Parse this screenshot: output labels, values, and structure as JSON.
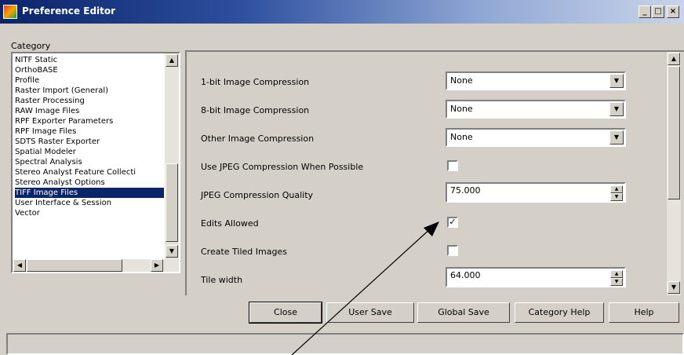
{
  "window": {
    "title": "Preference Editor",
    "minimize_label": "_",
    "maximize_label": "□",
    "close_label": "×"
  },
  "category": {
    "label": "Category",
    "items": [
      "NITF Static",
      "OrthoBASE",
      "Profile",
      "Raster Import (General)",
      "Raster Processing",
      "RAW Image Files",
      "RPF Exporter Parameters",
      "RPF Image Files",
      "SDTS Raster Exporter",
      "Spatial Modeler",
      "Spectral Analysis",
      "Stereo Analyst Feature Collecti",
      "Stereo Analyst Options",
      "TIFF Image Files",
      "User Interface & Session",
      "Vector"
    ],
    "selected": "TIFF Image Files"
  },
  "preferences": {
    "one_bit_label": "1-bit Image Compression",
    "one_bit_value": "None",
    "eight_bit_label": "8-bit Image Compression",
    "eight_bit_value": "None",
    "other_label": "Other Image Compression",
    "other_value": "None",
    "use_jpeg_label": "Use JPEG Compression When Possible",
    "use_jpeg_checked": false,
    "jpeg_quality_label": "JPEG Compression Quality",
    "jpeg_quality_value": "75.000",
    "edits_allowed_label": "Edits Allowed",
    "edits_allowed_checked": true,
    "create_tiled_label": "Create Tiled Images",
    "create_tiled_checked": false,
    "tile_width_label": "Tile width",
    "tile_width_value": "64.000"
  },
  "buttons": {
    "close": "Close",
    "user_save": "User Save",
    "global_save": "Global Save",
    "category_help": "Category Help",
    "help": "Help"
  },
  "glyphs": {
    "check": "✓",
    "arrow_down": "▼",
    "arrow_up": "▲",
    "arrow_left": "◀",
    "arrow_right": "▶"
  },
  "colors": {
    "selection": "#0a246a",
    "title_start": "#0b246a",
    "face": "#d4d0c8"
  }
}
